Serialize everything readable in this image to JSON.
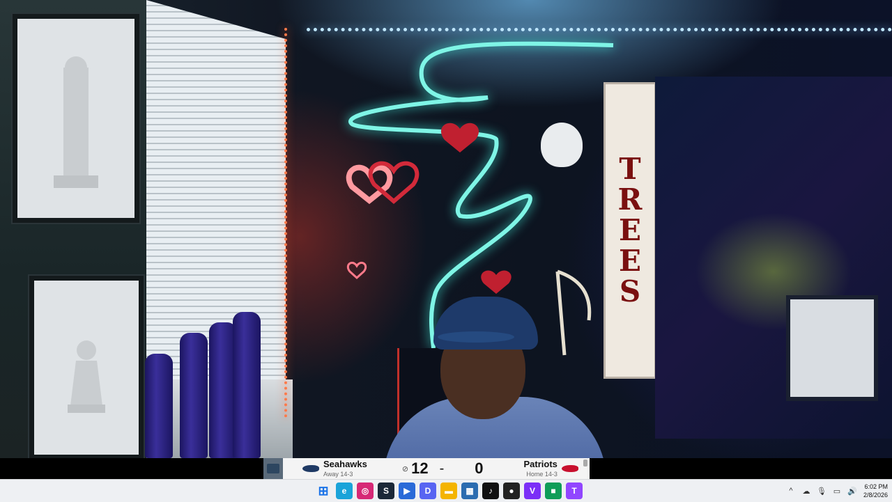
{
  "scoreboard": {
    "home": {
      "name": "Seahawks",
      "record": "Away 14-3",
      "score": "12",
      "logo_color": "#1f3a64"
    },
    "away": {
      "name": "Patriots",
      "record": "Home 14-3",
      "score": "0",
      "logo_color": "#c8102e"
    },
    "separator": "-",
    "possession_icon": "football-icon"
  },
  "taskbar": {
    "icons": [
      {
        "name": "start-icon",
        "glyph": "⊞",
        "color": "#1a73e8"
      },
      {
        "name": "edge-icon",
        "glyph": "e",
        "color": "#1aa3d9"
      },
      {
        "name": "instagram-icon",
        "glyph": "◎",
        "color": "#d62976"
      },
      {
        "name": "steam-icon",
        "glyph": "S",
        "color": "#1b2838"
      },
      {
        "name": "streaming-app-icon",
        "glyph": "▶",
        "color": "#2a6ad8"
      },
      {
        "name": "discord-icon",
        "glyph": "D",
        "color": "#5865f2"
      },
      {
        "name": "file-explorer-icon",
        "glyph": "▬",
        "color": "#f4b400"
      },
      {
        "name": "store-icon",
        "glyph": "▦",
        "color": "#2b6cb0"
      },
      {
        "name": "tiktok-icon",
        "glyph": "♪",
        "color": "#111111"
      },
      {
        "name": "obs-studio-icon",
        "glyph": "●",
        "color": "#222222"
      },
      {
        "name": "viber-icon",
        "glyph": "V",
        "color": "#7b2ff7"
      },
      {
        "name": "media-app-icon",
        "glyph": "■",
        "color": "#0f9d58"
      },
      {
        "name": "twitch-icon",
        "glyph": "T",
        "color": "#9146ff"
      }
    ],
    "tray": {
      "chevron": "^",
      "cloud": "☁",
      "mic": "🎙",
      "network": "▭",
      "volume": "🔊"
    },
    "clock": {
      "time": "6:02 PM",
      "date": "2/8/2026"
    }
  }
}
